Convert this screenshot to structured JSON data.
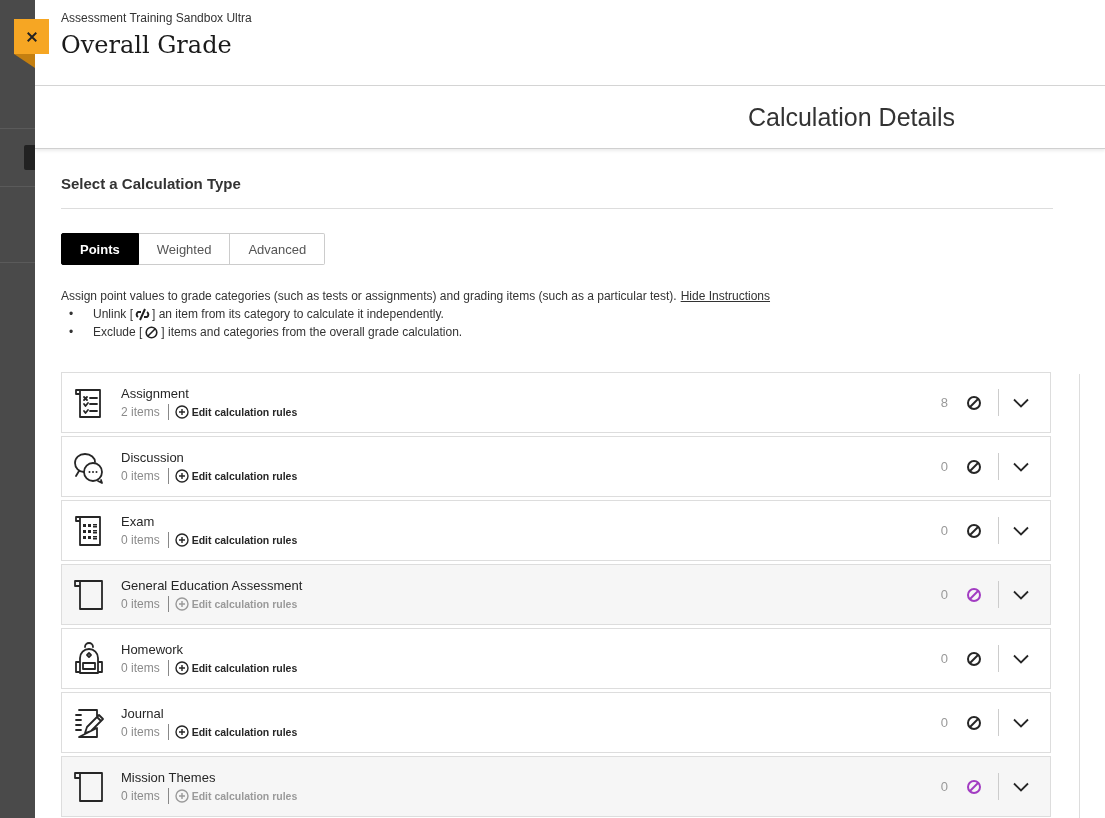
{
  "header": {
    "course": "Assessment Training Sandbox Ultra",
    "title": "Overall Grade"
  },
  "section_title": "Calculation Details",
  "calculation": {
    "heading": "Select a Calculation Type",
    "tabs": [
      {
        "label": "Points",
        "selected": true
      },
      {
        "label": "Weighted",
        "selected": false
      },
      {
        "label": "Advanced",
        "selected": false
      }
    ],
    "instructions": "Assign point values to grade categories (such as tests or assignments) and grading items (such as a particular test).",
    "hide_link": "Hide Instructions",
    "bullets": [
      {
        "marker": "•",
        "before": "Unlink [",
        "after": "] an item from its category to calculate it independently.",
        "kind": "unlink"
      },
      {
        "marker": "•",
        "before": "Exclude [",
        "after": "] items and categories from the overall grade calculation.",
        "kind": "exclude"
      }
    ]
  },
  "categories": [
    {
      "name": "Assignment",
      "count": "2 items",
      "edit": "Edit calculation rules",
      "points": "8",
      "excluded": false,
      "kind": "checklist"
    },
    {
      "name": "Discussion",
      "count": "0 items",
      "edit": "Edit calculation rules",
      "points": "0",
      "excluded": false,
      "kind": "chat"
    },
    {
      "name": "Exam",
      "count": "0 items",
      "edit": "Edit calculation rules",
      "points": "0",
      "excluded": false,
      "kind": "grid"
    },
    {
      "name": "General Education Assessment",
      "count": "0 items",
      "edit": "Edit calculation rules",
      "points": "0",
      "excluded": true,
      "kind": "page"
    },
    {
      "name": "Homework",
      "count": "0 items",
      "edit": "Edit calculation rules",
      "points": "0",
      "excluded": false,
      "kind": "backpack"
    },
    {
      "name": "Journal",
      "count": "0 items",
      "edit": "Edit calculation rules",
      "points": "0",
      "excluded": false,
      "kind": "journal"
    },
    {
      "name": "Mission Themes",
      "count": "0 items",
      "edit": "Edit calculation rules",
      "points": "0",
      "excluded": true,
      "kind": "page"
    }
  ]
}
